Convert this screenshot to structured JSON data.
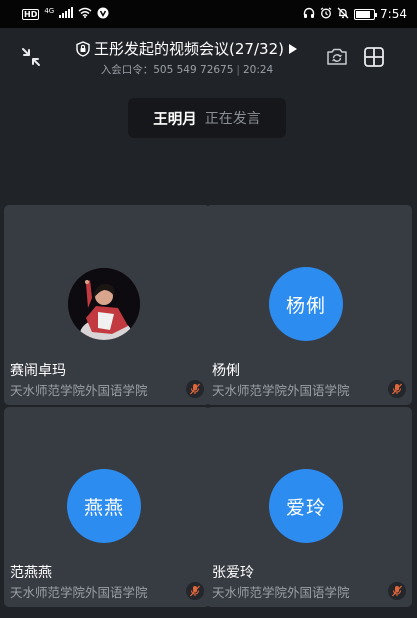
{
  "status_bar": {
    "hd_badge": "HD",
    "network": "4G",
    "time": "7:54",
    "battery_level": 0.85,
    "icons": [
      "signal-icon",
      "wifi-icon",
      "vpn-icon",
      "headset-icon",
      "alarm-icon",
      "mute-icon",
      "battery-icon"
    ]
  },
  "header": {
    "title": "王彤发起的视频会议(27/32)",
    "meeting_code_label": "入会口令：",
    "meeting_code": "505 549 72675",
    "duration": "20:24",
    "icons": [
      "collapse-icon",
      "lock-icon",
      "play-arrow-icon",
      "switch-camera-icon",
      "grid-view-icon"
    ]
  },
  "speaker": {
    "name": "王明月",
    "status": "正在发言"
  },
  "participants": [
    {
      "name": "赛闹卓玛",
      "org": "天水师范学院外国语学院",
      "avatar_text": "",
      "has_photo": true,
      "muted": true
    },
    {
      "name": "杨俐",
      "org": "天水师范学院外国语学院",
      "avatar_text": "杨俐",
      "has_photo": false,
      "muted": true
    },
    {
      "name": "范燕燕",
      "org": "天水师范学院外国语学院",
      "avatar_text": "燕燕",
      "has_photo": false,
      "muted": true
    },
    {
      "name": "张爱玲",
      "org": "天水师范学院外国语学院",
      "avatar_text": "爱玲",
      "has_photo": false,
      "muted": true
    }
  ],
  "colors": {
    "background": "#202328",
    "tile": "#373b42",
    "avatar": "#2d8cf0",
    "muted_mic": "#e0653a"
  }
}
